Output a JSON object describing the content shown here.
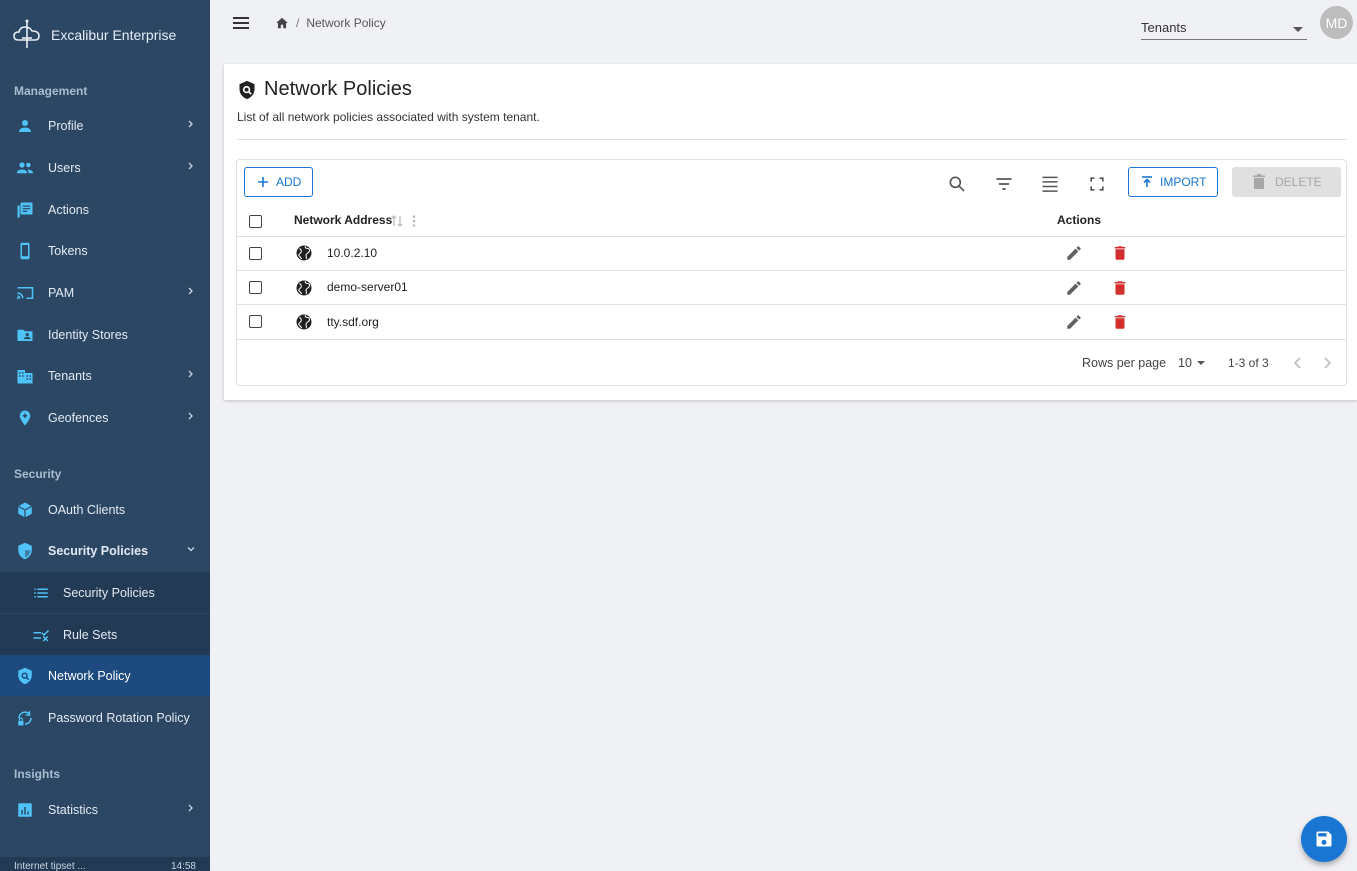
{
  "brand": {
    "name": "Excalibur Enterprise"
  },
  "sidebar": {
    "sections": {
      "management": "Management",
      "security": "Security",
      "insights": "Insights"
    },
    "items": {
      "profile": "Profile",
      "users": "Users",
      "actions": "Actions",
      "tokens": "Tokens",
      "pam": "PAM",
      "identity_stores": "Identity Stores",
      "tenants": "Tenants",
      "geofences": "Geofences",
      "oauth_clients": "OAuth Clients",
      "security_policies": "Security Policies",
      "security_policies_sub": "Security Policies",
      "rule_sets": "Rule Sets",
      "network_policy": "Network Policy",
      "password_rotation": "Password Rotation Policy",
      "statistics": "Statistics"
    },
    "footer": {
      "left": "Internet tipset ... ",
      "right": "14:58"
    },
    "colors": {
      "bg": "#2c4763",
      "active": "#1d4b80",
      "icon": "#4fc3f7"
    }
  },
  "topbar": {
    "breadcrumb": {
      "separator": "/",
      "current": "Network Policy"
    },
    "tenant_select": "Tenants",
    "avatar_initials": "MD"
  },
  "page": {
    "title": "Network Policies",
    "description": "List of all network policies associated with system tenant."
  },
  "grid": {
    "toolbar": {
      "add": "ADD",
      "import": "IMPORT",
      "delete": "DELETE"
    },
    "columns": {
      "address": "Network Address",
      "actions": "Actions"
    },
    "rows": [
      {
        "address": "10.0.2.10"
      },
      {
        "address": "demo-server01"
      },
      {
        "address": "tty.sdf.org"
      }
    ],
    "pagination": {
      "rows_per_page_label": "Rows per page",
      "rows_per_page": "10",
      "range": "1-3 of 3"
    }
  },
  "colors": {
    "primary": "#1976d2",
    "danger": "#d32f2f"
  }
}
